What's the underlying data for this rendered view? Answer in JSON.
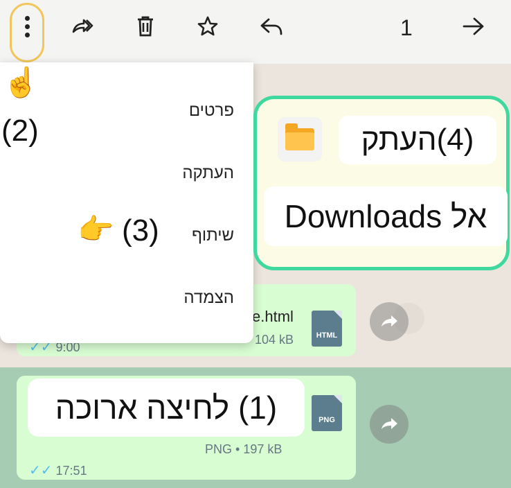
{
  "toolbar": {
    "selected_count": "1",
    "icons": [
      "back-arrow-icon",
      "reply-icon",
      "star-icon",
      "delete-icon",
      "forward-icon",
      "more-options-icon"
    ]
  },
  "overflow_menu": {
    "items": [
      {
        "label": "פרטים"
      },
      {
        "label": "העתקה"
      },
      {
        "label": "שיתוף"
      },
      {
        "label": "הצמדה"
      }
    ]
  },
  "callouts": {
    "step1": "(1) לחיצה ארוכה",
    "step2": "(2)",
    "step3": "(3)",
    "step4": "(4)העתק",
    "step4_target": "אל Downloads"
  },
  "messages": [
    {
      "filename": "e.html",
      "file_type": "HTML",
      "size": "104 kB",
      "time": "9:00"
    },
    {
      "file_type": "PNG",
      "size": "PNG • 197 kB",
      "time": "17:51"
    }
  ],
  "colors": {
    "highlight_yellow": "#f2c65a",
    "highlight_green": "#3fd9a0",
    "bubble_green": "#d9fdd3",
    "read_ticks": "#53bdeb"
  }
}
